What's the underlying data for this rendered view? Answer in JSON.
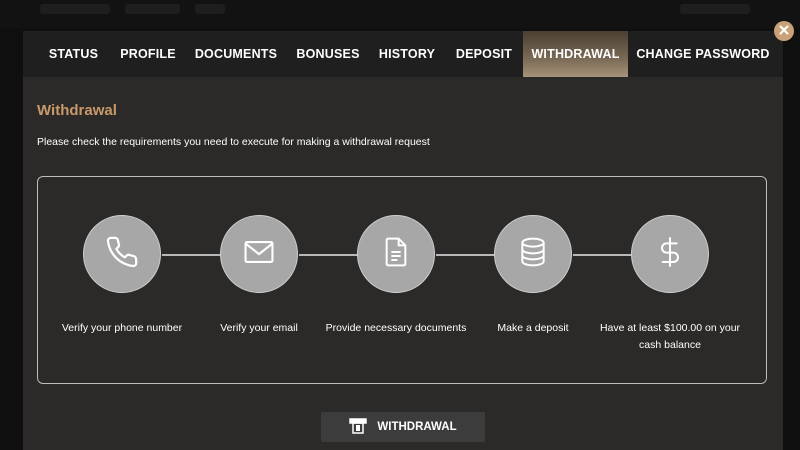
{
  "tabs": [
    {
      "label": "STATUS",
      "active": false
    },
    {
      "label": "PROFILE",
      "active": false
    },
    {
      "label": "DOCUMENTS",
      "active": false
    },
    {
      "label": "BONUSES",
      "active": false
    },
    {
      "label": "HISTORY",
      "active": false
    },
    {
      "label": "DEPOSIT",
      "active": false
    },
    {
      "label": "WITHDRAWAL",
      "active": true
    },
    {
      "label": "CHANGE PASSWORD",
      "active": false
    }
  ],
  "close_icon": "close-icon",
  "withdrawal": {
    "title": "Withdrawal",
    "description": "Please check the requirements you need to execute for making a withdrawal request",
    "steps": [
      {
        "icon": "phone-icon",
        "label": "Verify your phone number"
      },
      {
        "icon": "mail-icon",
        "label": "Verify your email"
      },
      {
        "icon": "document-icon",
        "label": "Provide necessary documents"
      },
      {
        "icon": "database-icon",
        "label": "Make a deposit"
      },
      {
        "icon": "dollar-icon",
        "label": "Have at least $100.00 on your cash balance"
      }
    ],
    "button": {
      "icon": "atm-icon",
      "label": "WITHDRAWAL"
    }
  },
  "colors": {
    "accent": "#c9996a",
    "close_button": "#c9a27a",
    "modal_bg": "#2b2a28",
    "tabbar_bg": "#1f1f1f",
    "step_circle": "#a7a7a7"
  }
}
